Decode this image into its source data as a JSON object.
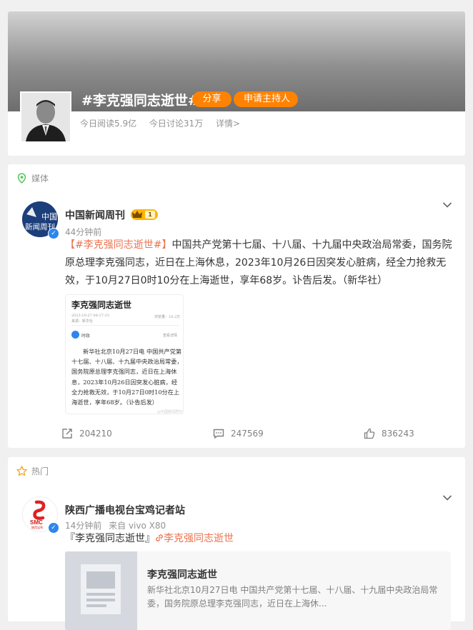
{
  "topic": {
    "title": "#李克强同志逝世#",
    "share_label": "分享",
    "host_label": "申请主持人",
    "read_stat": "今日阅读5.9亿",
    "discuss_stat": "今日讨论31万",
    "details_link": "详情>"
  },
  "sections": {
    "media_label": "媒体",
    "hot_label": "热门"
  },
  "post1": {
    "avatar_text_line1": "中国",
    "avatar_text_line2": "新闻周刊",
    "author": "中国新闻周刊",
    "rank_badge": "1",
    "time": "44分钟前",
    "bracket_open": "【",
    "hashtag": "#李克强同志逝世#",
    "bracket_close": "】",
    "text": "中国共产党第十七届、十八届、十九届中央政治局常委，国务院原总理李克强同志，近日在上海休息，2023年10月26日因突发心脏病，经全力抢救无效，于10月27日0时10分在上海逝世，享年68岁。讣告后发。（新华社）",
    "image": {
      "title": "李克强同志逝世",
      "date_line": "2023-10-27 08:17:33",
      "source_line": "来源：新华社",
      "view_count": "浏览量：18.2万",
      "author_name": "时政",
      "view_more": "查看详情",
      "body": "新华社北京10月27日电 中国共产党第十七届、十八届、十九届中央政治局常委，国务院原总理李克强同志，近日在上海休息，2023年10月26日因突发心脏病，经全力抢救无效，于10月27日0时10分在上海逝世，享年68岁。（讣告后发）",
      "watermark": "@中国新闻周刊"
    },
    "reposts": "204210",
    "comments": "247569",
    "likes": "836243"
  },
  "post2": {
    "avatar_text_top": "SMC",
    "avatar_text_bottom": "陕西宝鸡",
    "author": "陕西广播电视台宝鸡记者站",
    "time": "14分钟前",
    "source_prefix": "来自",
    "source_device": "vivo X80",
    "text_prefix": "『李克强同志逝世』",
    "link_label": "李克强同志逝世",
    "link_card": {
      "title": "李克强同志逝世",
      "desc": "新华社北京10月27日电 中国共产党第十七届、十八届、十九届中央政治局常委，国务院原总理李克强同志，近日在上海休..."
    }
  },
  "colors": {
    "accent": "#ff8200",
    "hashtag": "#eb7350",
    "verified": "#2d86ec",
    "hot_icon": "#f6a623",
    "media_icon": "#4fc85a"
  },
  "icons": [
    "media-location-icon",
    "hot-star-icon",
    "chevron-down-icon",
    "repost-icon",
    "comment-icon",
    "like-icon",
    "verified-icon",
    "rank-crown-icon",
    "link-icon"
  ]
}
